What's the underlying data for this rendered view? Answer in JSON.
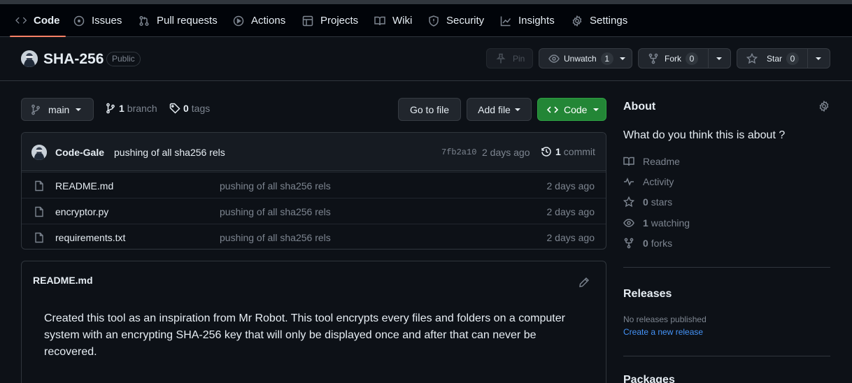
{
  "nav": {
    "tabs": [
      {
        "label": "Code",
        "icon": "code-icon"
      },
      {
        "label": "Issues",
        "icon": "issue-icon"
      },
      {
        "label": "Pull requests",
        "icon": "pull-request-icon"
      },
      {
        "label": "Actions",
        "icon": "play-icon"
      },
      {
        "label": "Projects",
        "icon": "table-icon"
      },
      {
        "label": "Wiki",
        "icon": "book-icon"
      },
      {
        "label": "Security",
        "icon": "shield-icon"
      },
      {
        "label": "Insights",
        "icon": "graph-icon"
      },
      {
        "label": "Settings",
        "icon": "gear-icon"
      }
    ]
  },
  "repo": {
    "name": "SHA-256",
    "visibility": "Public",
    "pin_label": "Pin",
    "unwatch_label": "Unwatch",
    "watch_count": "1",
    "fork_label": "Fork",
    "fork_count": "0",
    "star_label": "Star",
    "star_count": "0"
  },
  "toolbar": {
    "branch": "main",
    "branch_count": "1",
    "branch_label": "branch",
    "tag_count": "0",
    "tag_label": "tags",
    "go_to_file": "Go to file",
    "add_file": "Add file",
    "code": "Code"
  },
  "commit": {
    "author": "Code-Gale",
    "message": "pushing of all sha256 rels",
    "hash": "7fb2a10",
    "time": "2 days ago",
    "count": "1",
    "count_label": "commit"
  },
  "files": [
    {
      "name": "README.md",
      "message": "pushing of all sha256 rels",
      "date": "2 days ago"
    },
    {
      "name": "encryptor.py",
      "message": "pushing of all sha256 rels",
      "date": "2 days ago"
    },
    {
      "name": "requirements.txt",
      "message": "pushing of all sha256 rels",
      "date": "2 days ago"
    }
  ],
  "readme": {
    "title": "README.md",
    "body": "Created this tool as an inspiration from Mr Robot. This tool encrypts every files and folders on a computer system with an encrypting SHA-256 key that will only be displayed once and after that can never be recovered."
  },
  "about": {
    "heading": "About",
    "description": "What do you think this is about ?",
    "readme": "Readme",
    "activity": "Activity",
    "stars_count": "0",
    "stars_label": "stars",
    "watching_count": "1",
    "watching_label": "watching",
    "forks_count": "0",
    "forks_label": "forks"
  },
  "releases": {
    "heading": "Releases",
    "none": "No releases published",
    "create": "Create a new release"
  },
  "packages": {
    "heading": "Packages"
  },
  "colors": {
    "background": "#0d1117",
    "nav_background": "#010409",
    "accent_underline": "#f78166",
    "primary_button": "#238636",
    "link": "#4493f8"
  }
}
